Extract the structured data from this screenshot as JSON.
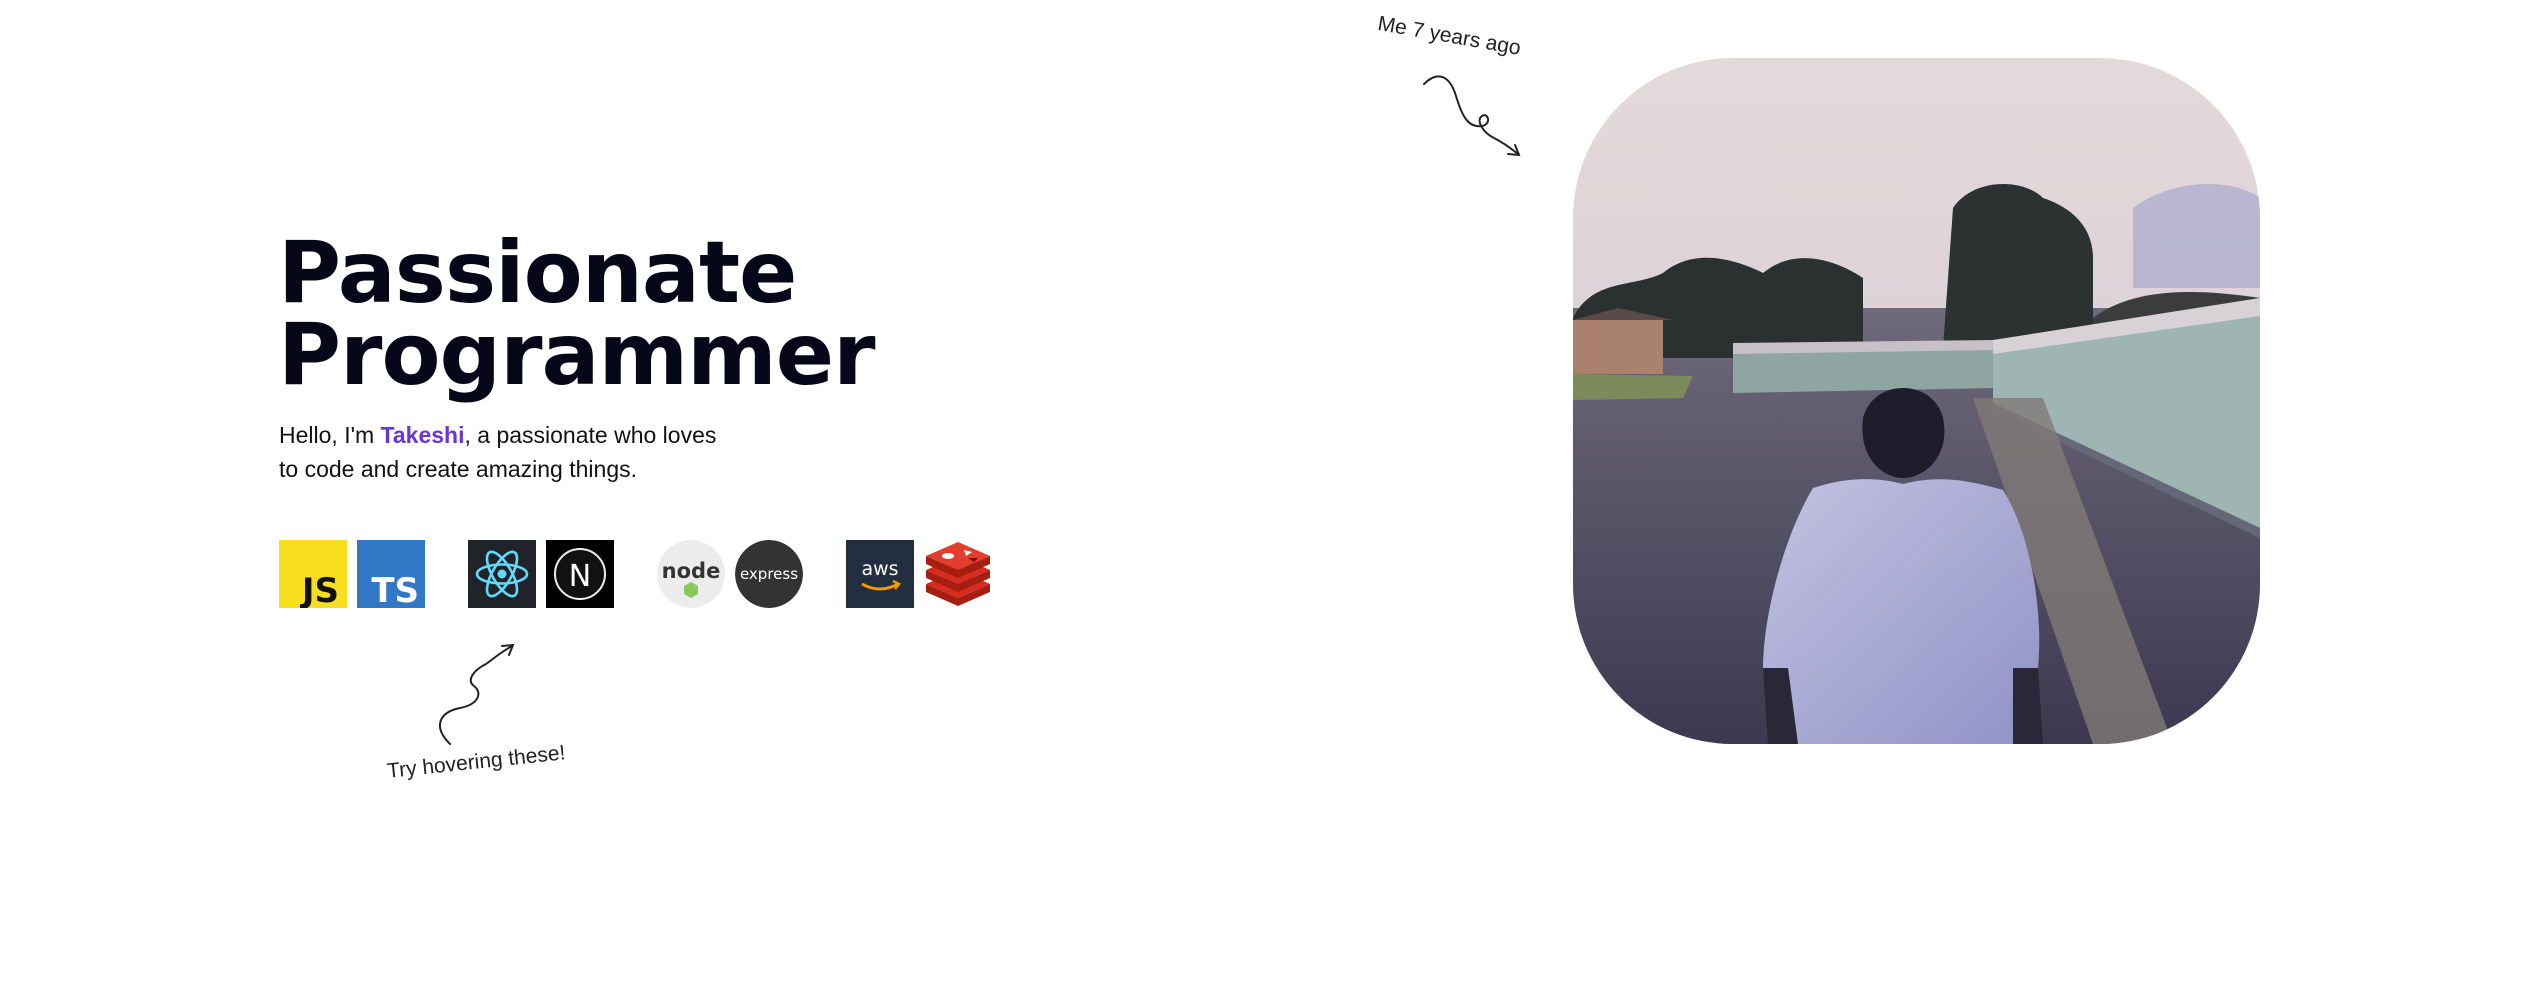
{
  "hero": {
    "title_line1": "Passionate",
    "title_line2": "Programmer",
    "intro_prefix": "Hello, I'm ",
    "intro_name": "Takeshi",
    "intro_line1_suffix": ", a passionate who loves",
    "intro_line2": "to code and create amazing things."
  },
  "tech_stack": [
    {
      "name": "javascript-icon",
      "label": "JS"
    },
    {
      "name": "typescript-icon",
      "label": "TS"
    },
    {
      "name": "react-icon"
    },
    {
      "name": "nextjs-icon",
      "label": "N"
    },
    {
      "name": "nodejs-icon",
      "label": "node"
    },
    {
      "name": "express-icon",
      "label": "express"
    },
    {
      "name": "aws-icon",
      "label": "aws"
    },
    {
      "name": "redis-icon"
    }
  ],
  "hint_text": "Try hovering these!",
  "photo_caption": "Me 7 years ago",
  "colors": {
    "accent": "#6a34d6",
    "js_yellow": "#f7df1e",
    "ts_blue": "#3178c6",
    "react_dark": "#20232a",
    "react_cyan": "#61dafb",
    "aws_dark": "#232f3e",
    "aws_orange": "#ff9900",
    "redis_red": "#c6302b"
  }
}
